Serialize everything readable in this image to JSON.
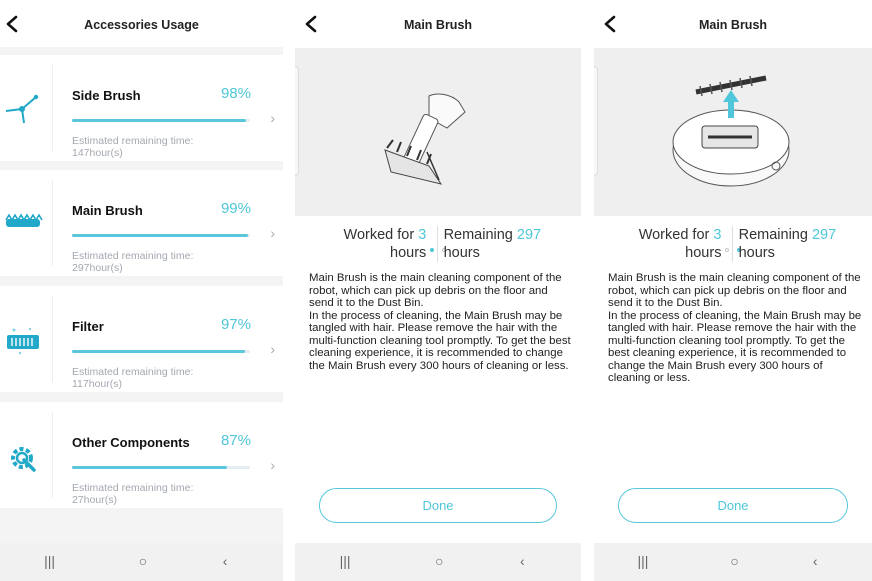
{
  "list_screen": {
    "title": "Accessories Usage",
    "items": [
      {
        "name": "Side Brush",
        "percent_label": "98%",
        "percent": 98,
        "est_label": "Estimated remaining time:",
        "est_value": "147hour(s)",
        "icon": "side-brush-icon"
      },
      {
        "name": "Main Brush",
        "percent_label": "99%",
        "percent": 99,
        "est_label": "Estimated remaining time:",
        "est_value": "297hour(s)",
        "icon": "main-brush-icon"
      },
      {
        "name": "Filter",
        "percent_label": "97%",
        "percent": 97,
        "est_label": "Estimated remaining time:",
        "est_value": "117hour(s)",
        "icon": "filter-icon"
      },
      {
        "name": "Other Components",
        "percent_label": "87%",
        "percent": 87,
        "est_label": "Estimated remaining time:",
        "est_value": "27hour(s)",
        "icon": "wrench-gear-icon"
      }
    ]
  },
  "detail_screens": [
    {
      "title": "Main Brush",
      "active_dot": 0,
      "worked_label": "Worked for",
      "worked_value": "3",
      "worked_unit": "hours",
      "remaining_label": "Remaining",
      "remaining_value": "297",
      "remaining_unit": "hours",
      "desc_1": "Main Brush is the main cleaning component of the robot, which can pick up debris on the floor and send it to the Dust Bin.",
      "desc_2": " In the process of cleaning, the Main Brush may be tangled with hair. Please remove the hair with the multi-function cleaning tool promptly. To get the best cleaning experience, it is recommended to change the Main Brush every 300 hours of cleaning or less.",
      "done_label": "Done"
    },
    {
      "title": "Main Brush",
      "active_dot": 1,
      "worked_label": "Worked for",
      "worked_value": "3",
      "worked_unit": "hours",
      "remaining_label": "Remaining",
      "remaining_value": "297",
      "remaining_unit": "hours",
      "desc_1": "Main Brush is the main cleaning component of the robot, which can pick up debris on the floor and send it to the Dust Bin.",
      "desc_2": " In the process of cleaning, the Main Brush may be tangled with hair. Please remove the hair with the multi-function cleaning tool promptly. To get the best cleaning experience, it is recommended to change the Main Brush every 300 hours of cleaning or less.",
      "done_label": "Done"
    }
  ],
  "nav": {
    "recent": "|||",
    "home": "○",
    "back": "‹"
  },
  "colors": {
    "accent": "#4fc6d9",
    "bar": "#5ac7dc",
    "background": "#f4f4f5",
    "muted_text": "#a3a9b0"
  }
}
